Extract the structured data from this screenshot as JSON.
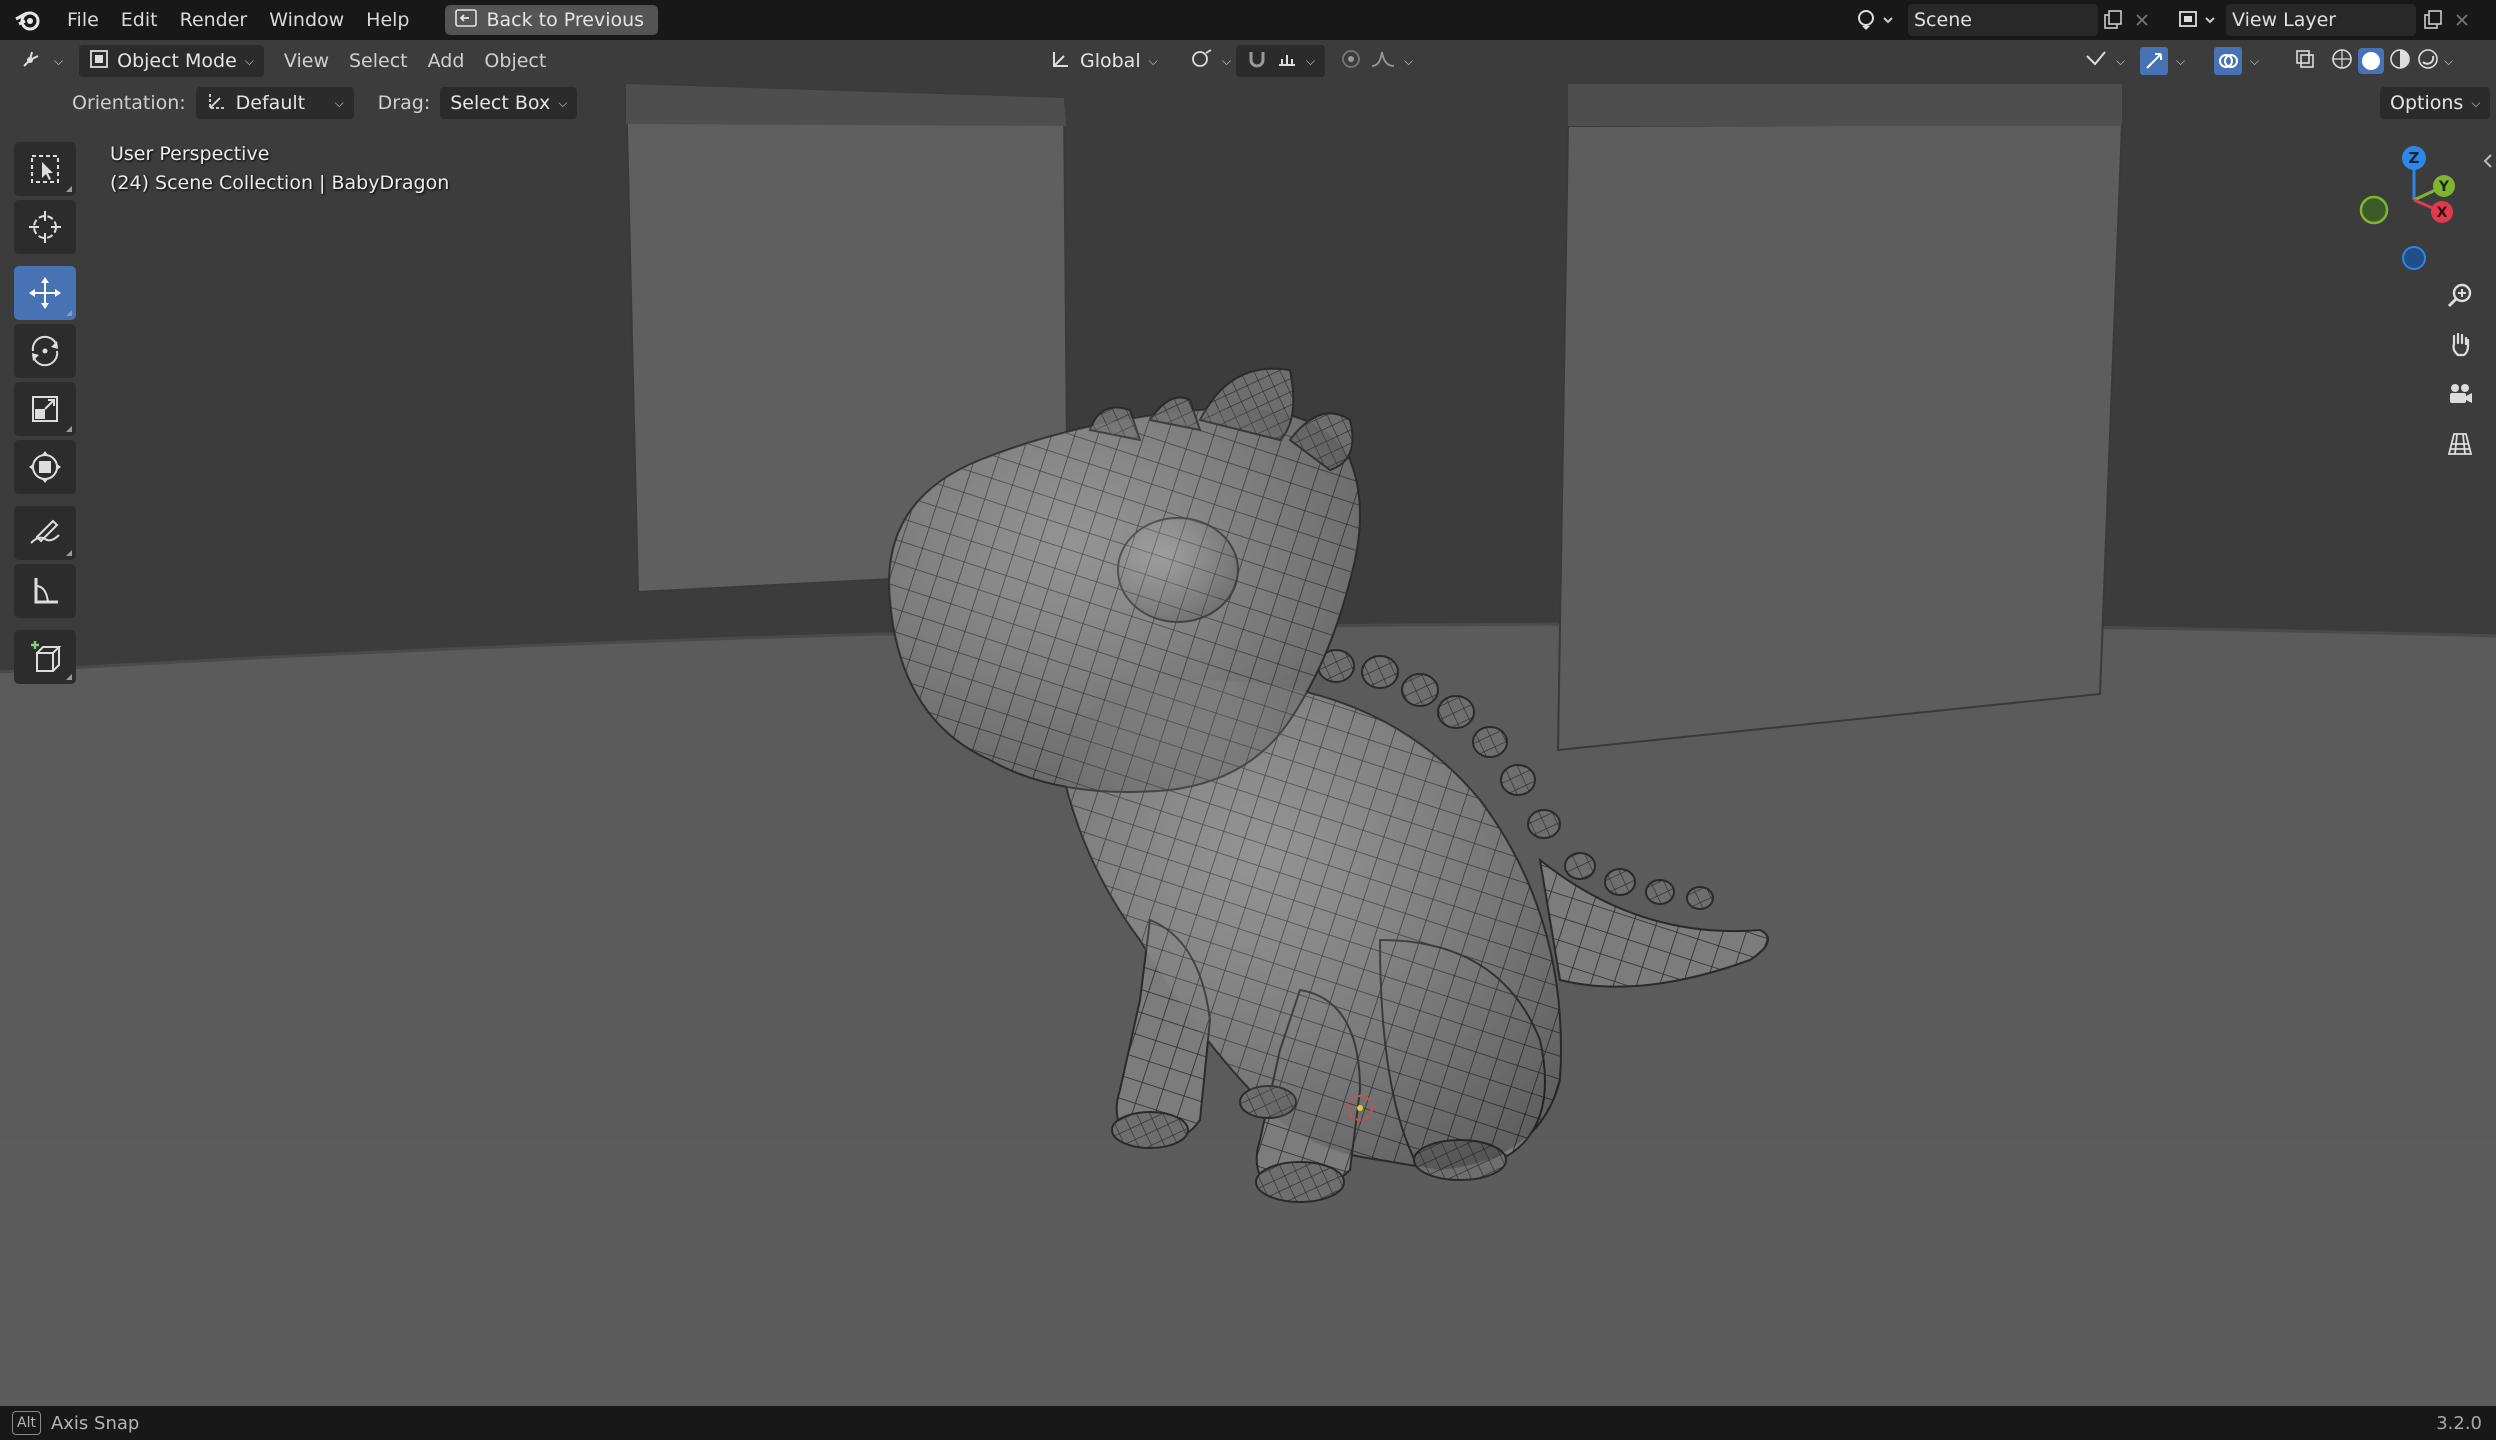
{
  "menubar": {
    "items": [
      "File",
      "Edit",
      "Render",
      "Window",
      "Help"
    ],
    "back_label": "Back to Previous",
    "scene": "Scene",
    "view_layer": "View Layer"
  },
  "header": {
    "mode": "Object Mode",
    "menus": [
      "View",
      "Select",
      "Add",
      "Object"
    ],
    "transform_orientation": "Global"
  },
  "tool_header": {
    "orientation_label": "Orientation:",
    "orientation_value": "Default",
    "drag_label": "Drag:",
    "drag_value": "Select Box",
    "options_label": "Options"
  },
  "viewport": {
    "perspective": "User Perspective",
    "collection": "(24) Scene Collection | BabyDragon",
    "gizmo_axes": [
      "Z",
      "Y",
      "X"
    ]
  },
  "toolbar": {
    "tools": [
      "select-box",
      "cursor",
      "move",
      "rotate",
      "scale",
      "transform",
      "annotate",
      "measure",
      "add-cube"
    ],
    "active": "move"
  },
  "statusbar": {
    "key": "Alt",
    "hint": "Axis Snap",
    "version": "3.2.0"
  },
  "colors": {
    "accent": "#4772b3",
    "axis_x": "#e03a4e",
    "axis_y": "#7fb530",
    "axis_z": "#2e86e6"
  }
}
